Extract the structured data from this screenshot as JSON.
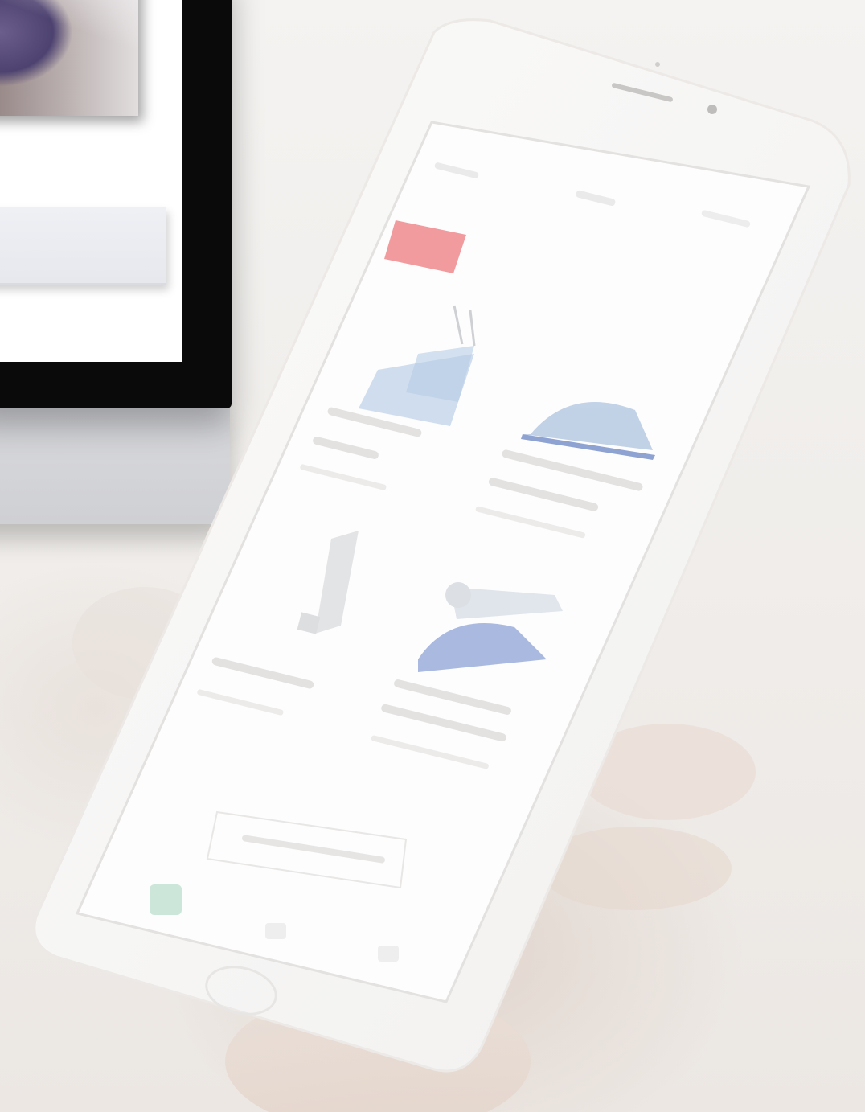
{
  "scene": {
    "colors": {
      "background": "#f1efed",
      "monitor_bezel": "#0b0a0a",
      "monitor_chin": "#d4d5d9",
      "phone_body": "#fafafa",
      "phone_screen": "#fdfdfd",
      "badge_red": "#ef8a8e",
      "product_blue": "#8fa9d6"
    }
  },
  "monitor": {
    "description_icon": "desktop-monitor-icon"
  },
  "phone": {
    "icons": {
      "speaker": "speaker-slot-icon",
      "camera": "front-camera-icon",
      "home_button": "home-button-icon",
      "back": "back-chevron-icon",
      "tab": "tab-bar-icon"
    },
    "products": [
      {
        "name_icon": "jar-product-icon"
      },
      {
        "name_icon": "tent-product-icon"
      },
      {
        "name_icon": "tube-product-icon"
      },
      {
        "name_icon": "pump-product-icon"
      }
    ]
  }
}
